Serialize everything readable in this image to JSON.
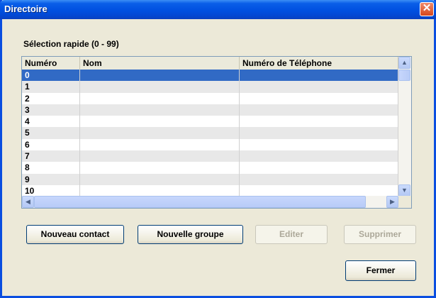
{
  "window": {
    "title": "Directoire"
  },
  "group": {
    "label": "Sélection rapide (0 - 99)"
  },
  "list": {
    "columns": [
      "Numéro",
      "Nom",
      "Numéro de Téléphone"
    ],
    "rows": [
      {
        "numero": "0",
        "nom": "",
        "telephone": ""
      },
      {
        "numero": "1",
        "nom": "",
        "telephone": ""
      },
      {
        "numero": "2",
        "nom": "",
        "telephone": ""
      },
      {
        "numero": "3",
        "nom": "",
        "telephone": ""
      },
      {
        "numero": "4",
        "nom": "",
        "telephone": ""
      },
      {
        "numero": "5",
        "nom": "",
        "telephone": ""
      },
      {
        "numero": "6",
        "nom": "",
        "telephone": ""
      },
      {
        "numero": "7",
        "nom": "",
        "telephone": ""
      },
      {
        "numero": "8",
        "nom": "",
        "telephone": ""
      },
      {
        "numero": "9",
        "nom": "",
        "telephone": ""
      },
      {
        "numero": "10",
        "nom": "",
        "telephone": ""
      }
    ],
    "selected_row": "0"
  },
  "buttons": {
    "new_contact": "Nouveau contact",
    "new_group": "Nouvelle groupe",
    "edit": "Editer",
    "delete": "Supprimer",
    "close": "Fermer"
  },
  "colors": {
    "titlebar": "#0050e0",
    "selection": "#316ac5",
    "dialog_bg": "#ece9d8",
    "close_button": "#d6461c"
  },
  "icons": {
    "close": "close-icon",
    "scroll_up": "arrow-up-icon",
    "scroll_down": "arrow-down-icon",
    "scroll_left": "arrow-left-icon",
    "scroll_right": "arrow-right-icon"
  }
}
